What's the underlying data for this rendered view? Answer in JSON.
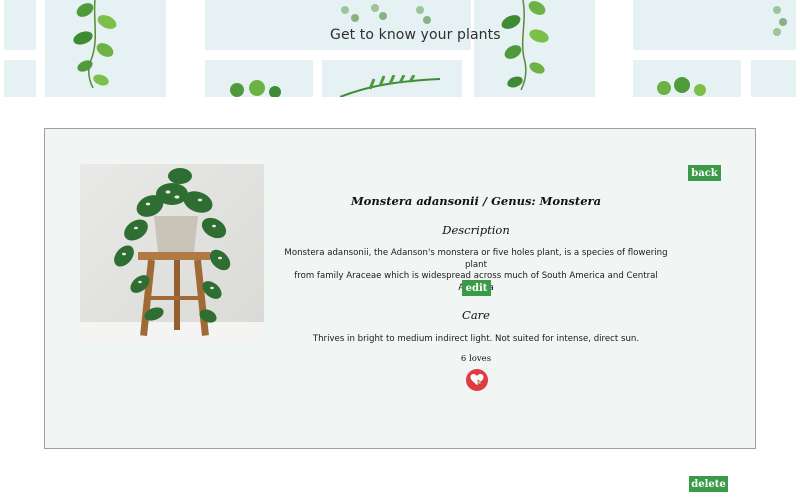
{
  "banner": {
    "title": "Get to know your plants",
    "decor_icon": "hanging-vine-icon"
  },
  "plant": {
    "title": "Monstera adansonii / Genus: Monstera",
    "image_alt": "potted monstera plant on wooden stool",
    "description_heading": "Description",
    "description_line1": "Monstera adansonii, the Adanson's monstera or five holes plant, is a species of flowering plant",
    "description_line2": "from family Araceae which is widespread across much of South America and Central America",
    "care_heading": "Care",
    "care_text": "Thrives in bright to medium indirect light. Not suited for intense, direct sun.",
    "loves_text": "6 loves"
  },
  "buttons": {
    "back_label": "back",
    "edit_label": "edit",
    "delete_label": "delete",
    "love_icon": "heart-hand-icon"
  },
  "colors": {
    "button_green": "#3a9a48",
    "love_red": "#e03a44",
    "card_bg": "#f1f5f3",
    "tile_blue": "#e6f1f3"
  }
}
